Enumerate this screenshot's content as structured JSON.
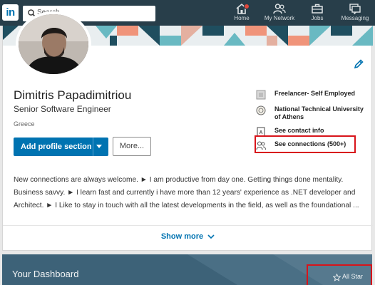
{
  "nav": {
    "logo_text": "in",
    "search_placeholder": "Search",
    "items": [
      {
        "label": "Home",
        "icon": "home-icon"
      },
      {
        "label": "My Network",
        "icon": "network-icon"
      },
      {
        "label": "Jobs",
        "icon": "jobs-icon"
      },
      {
        "label": "Messaging",
        "icon": "messaging-icon"
      }
    ],
    "colors": {
      "bar": "#283e4a",
      "badge": "#e0483c"
    }
  },
  "profile": {
    "name": "Dimitris Papadimitriou",
    "headline": "Senior Software Engineer",
    "location": "Greece",
    "add_section_label": "Add profile section",
    "more_label": "More...",
    "side": {
      "company": "Freelancer- Self Employed",
      "school": "National Technical University of Athens",
      "contact": "See contact info",
      "connections": "See connections (500+)"
    },
    "summary_lines": [
      "New connections are always welcome. ► I am productive from day one. Getting things done mentality.",
      "Business savvy. ► I learn fast and currently i have more than 12 years' experience as .NET developer and",
      "Architect. ► I Like to stay in touch with all the latest developments in the field, as well as the foundational ..."
    ],
    "show_more_label": "Show more",
    "accent": "#0073b1",
    "highlight": "#d8141a"
  },
  "dashboard": {
    "title": "Your Dashboard",
    "all_star": "All Star"
  }
}
